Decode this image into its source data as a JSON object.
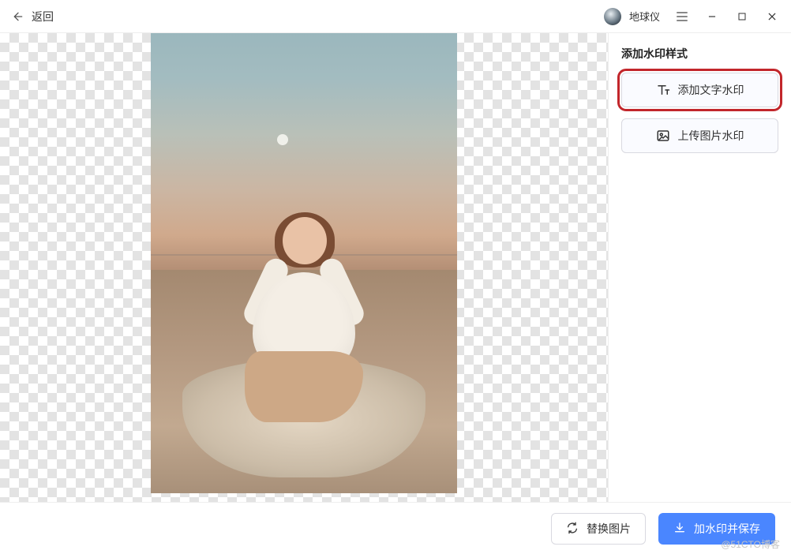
{
  "header": {
    "back_label": "返回",
    "username": "地球仪"
  },
  "sidebar": {
    "title": "添加水印样式",
    "text_watermark_label": "添加文字水印",
    "image_watermark_label": "上传图片水印"
  },
  "footer": {
    "replace_image_label": "替换图片",
    "save_label": "加水印并保存",
    "page_watermark": "@51CTO博客"
  },
  "icons": {
    "back": "arrow-left-icon",
    "menu": "menu-icon",
    "minimize": "minimize-icon",
    "maximize": "maximize-icon",
    "close": "close-icon",
    "text": "text-icon",
    "image": "image-icon",
    "replace": "replace-icon",
    "download": "download-icon"
  }
}
